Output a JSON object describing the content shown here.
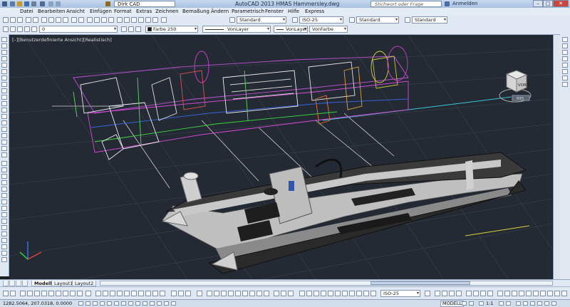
{
  "titlebar": {
    "workspace": "Dirk CAD",
    "title": "AutoCAD 2013   HMAS Hammersley.dwg",
    "search_placeholder": "Stichwort oder Frage eingeben",
    "login": "Anmelden",
    "min": "–",
    "max": "□",
    "close": "✕"
  },
  "menu": {
    "items": [
      "Datei",
      "Bearbeiten",
      "Ansicht",
      "Einfügen",
      "Format",
      "Extras",
      "Zeichnen",
      "Bemaßung",
      "Ändern",
      "Parametrisch",
      "Fenster",
      "Hilfe",
      "Express"
    ]
  },
  "toolbar1": {
    "text_style": "Standard",
    "dim_style": "ISO-25",
    "table_style": "Standard",
    "mleader_style": "Standard"
  },
  "toolbar2": {
    "layer": "0",
    "color": "Farbe 250",
    "linetype": "VonLayer",
    "lineweight": "VonLayer",
    "plotstyle": "VonFarbe"
  },
  "viewport": {
    "label": "[–][Benutzerdefinierte Ansicht][Realistisch]",
    "viewcube_face": "VORNE",
    "wcs": "WKS"
  },
  "tabs": [
    "Modell",
    "Layout1",
    "Layout2"
  ],
  "bottom": {
    "dim_combo": "ISO-25"
  },
  "status": {
    "coords": "1282.5064, 207.0318, 0.0000",
    "model": "MODELL",
    "scale": "1:1"
  }
}
